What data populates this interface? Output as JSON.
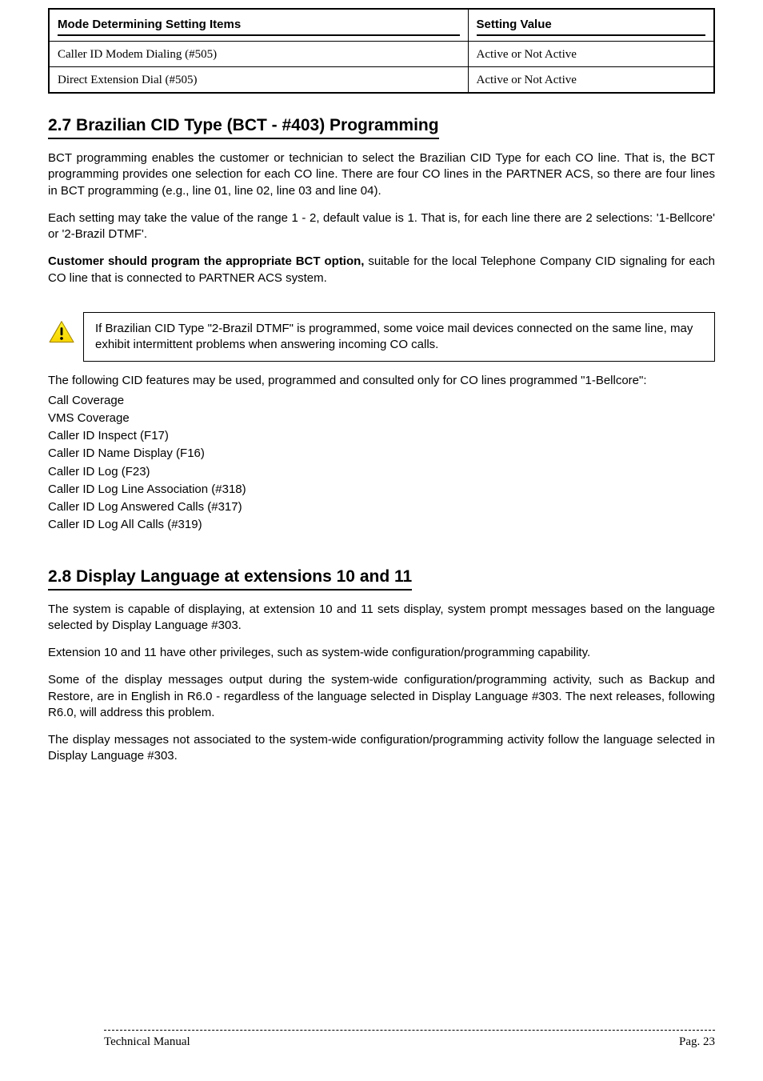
{
  "table": {
    "header_left": "Mode Determining Setting Items",
    "header_right": "Setting Value",
    "rows": [
      {
        "left": "Caller ID Modem Dialing (#505)",
        "right": "Active or Not Active"
      },
      {
        "left": "Direct Extension Dial (#505)",
        "right": "Active or Not Active"
      }
    ]
  },
  "section1": {
    "heading": "2.7 Brazilian CID Type (BCT - #403) Programming",
    "p1": "BCT programming enables the customer or technician to select the Brazilian CID Type for each CO line. That is, the BCT programming provides one selection for each CO line. There are four CO lines in the PARTNER ACS, so there are four lines in BCT programming (e.g., line 01, line 02, line 03 and line 04).",
    "p2": "Each setting may take the value of the range 1 - 2, default value is 1. That is, for each line there are 2 selections: '1-Bellcore' or '2-Brazil DTMF'.",
    "p3_bold": "Customer should program the appropriate BCT option,",
    "p3_rest": " suitable for the local Telephone Company CID signaling for each CO line that is connected to PARTNER ACS system."
  },
  "warning": {
    "text": "If Brazilian CID Type \"2-Brazil DTMF\" is programmed, some voice mail devices connected on the same line, may exhibit intermittent problems when answering incoming CO calls."
  },
  "section1_tail": [
    "The following CID features may be used, programmed and consulted only for CO lines programmed \"1-Bellcore\":",
    "Call Coverage",
    "VMS Coverage",
    "Caller ID Inspect (F17)",
    "Caller ID Name Display (F16)",
    "Caller ID Log (F23)",
    "Caller ID Log Line Association (#318)",
    "Caller ID Log Answered Calls (#317)",
    "Caller ID Log All Calls (#319)"
  ],
  "section2": {
    "heading": "2.8 Display Language at extensions 10 and 11",
    "p1": "The system is capable of displaying, at extension 10 and 11 sets display, system prompt messages based on the language selected by Display Language #303.",
    "p2": "Extension 10 and 11 have other privileges, such as system-wide configuration/programming capability.",
    "p3": "Some of the display messages output during the system-wide configuration/programming activity, such as Backup and Restore, are in English in R6.0 - regardless of the language selected in Display Language #303. The next releases, following R6.0, will address this problem.",
    "p4": "The display messages not associated to the system-wide configuration/programming activity follow the language selected in Display Language #303."
  },
  "footer": {
    "left": "Technical Manual",
    "right": "Pag. 23"
  }
}
